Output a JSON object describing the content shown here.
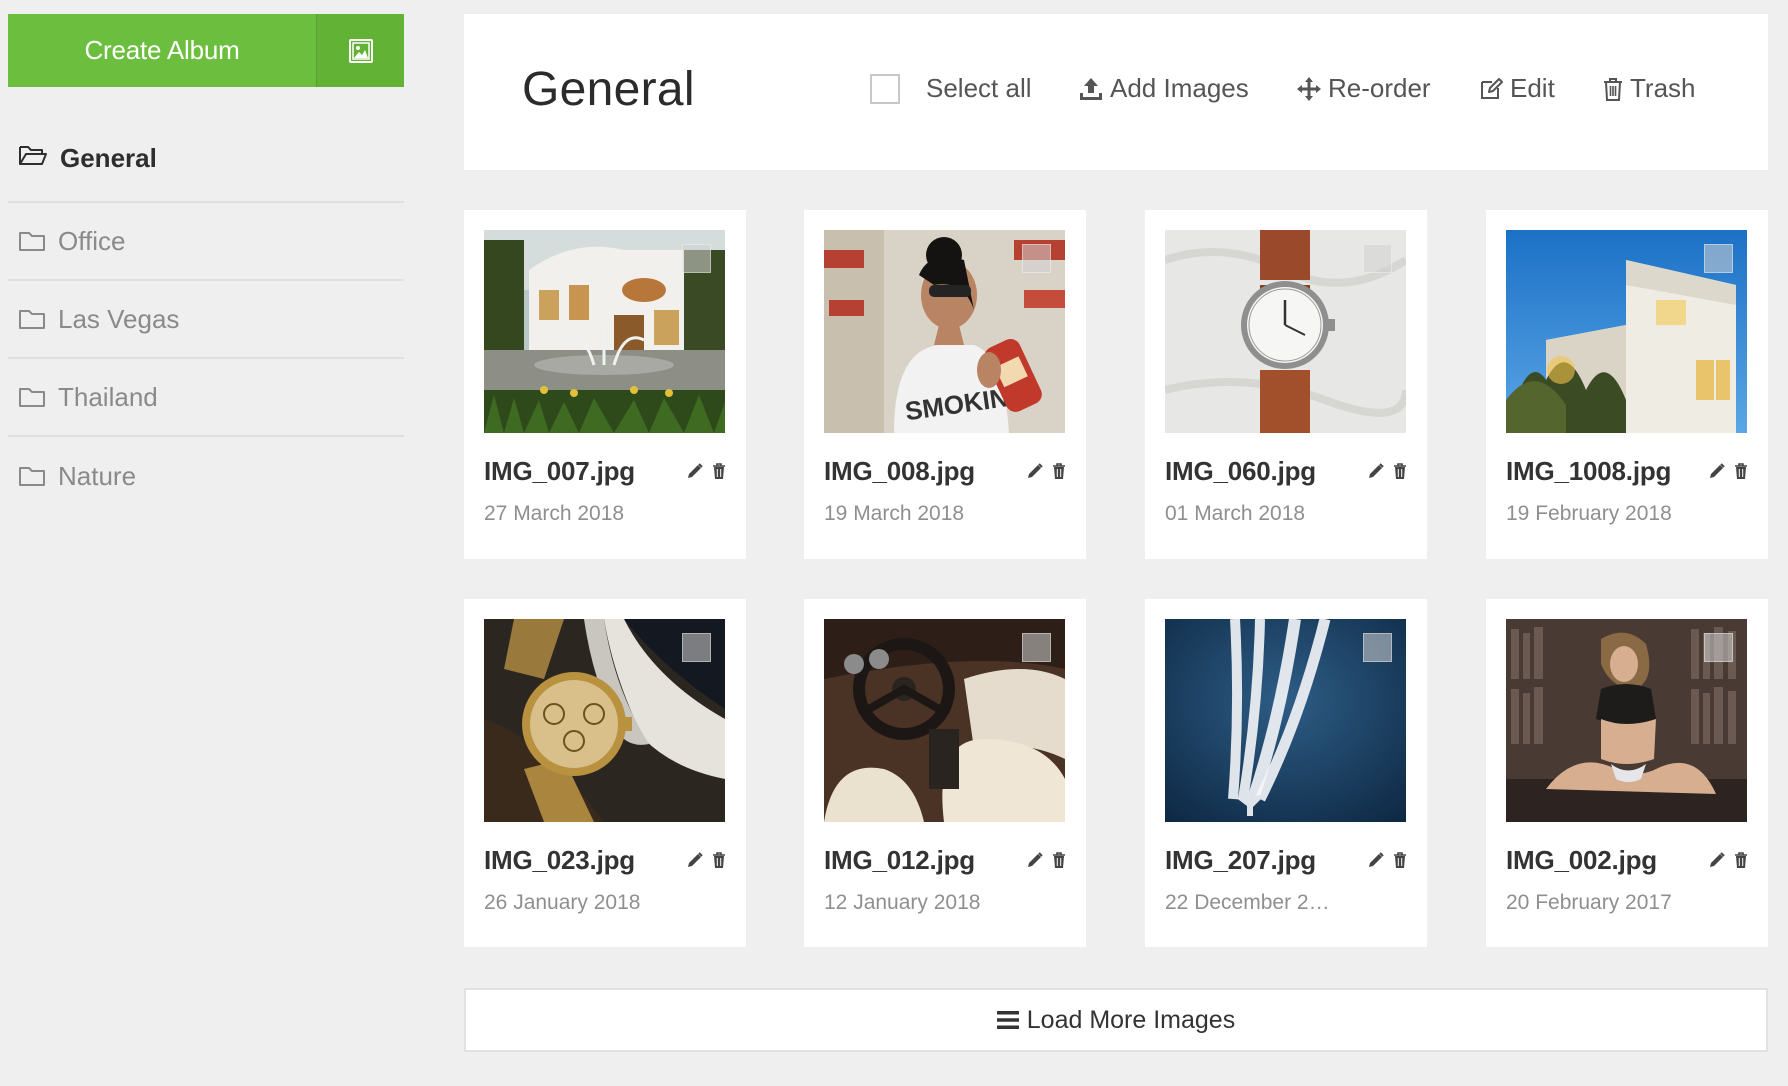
{
  "sidebar": {
    "create_label": "Create Album",
    "albums": [
      {
        "label": "General",
        "active": true
      },
      {
        "label": "Office"
      },
      {
        "label": "Las Vegas"
      },
      {
        "label": "Thailand"
      },
      {
        "label": "Nature"
      }
    ]
  },
  "header": {
    "title": "General",
    "select_all_label": "Select all",
    "add_images_label": "Add Images",
    "reorder_label": "Re-order",
    "edit_label": "Edit",
    "trash_label": "Trash"
  },
  "images": [
    {
      "name": "IMG_007.jpg",
      "date": "27 March 2018",
      "subject": "white-mansion-with-fountain"
    },
    {
      "name": "IMG_008.jpg",
      "date": "19 March 2018",
      "subject": "woman-in-sunglasses-with-drink"
    },
    {
      "name": "IMG_060.jpg",
      "date": "01 March 2018",
      "subject": "wristwatch-brown-strap"
    },
    {
      "name": "IMG_1008.jpg",
      "date": "19 February 2018",
      "subject": "modern-house-blue-sky"
    },
    {
      "name": "IMG_023.jpg",
      "date": "26 January 2018",
      "subject": "gold-wristwatch"
    },
    {
      "name": "IMG_012.jpg",
      "date": "12 January 2018",
      "subject": "car-interior"
    },
    {
      "name": "IMG_207.jpg",
      "date": "22 December 2…",
      "subject": "airplane-contrails"
    },
    {
      "name": "IMG_002.jpg",
      "date": "20 February 2017",
      "subject": "woman-library"
    }
  ],
  "load_more_label": "Load More Images",
  "colors": {
    "accent": "#6cbf3e",
    "background": "#efefef",
    "card": "#ffffff"
  }
}
